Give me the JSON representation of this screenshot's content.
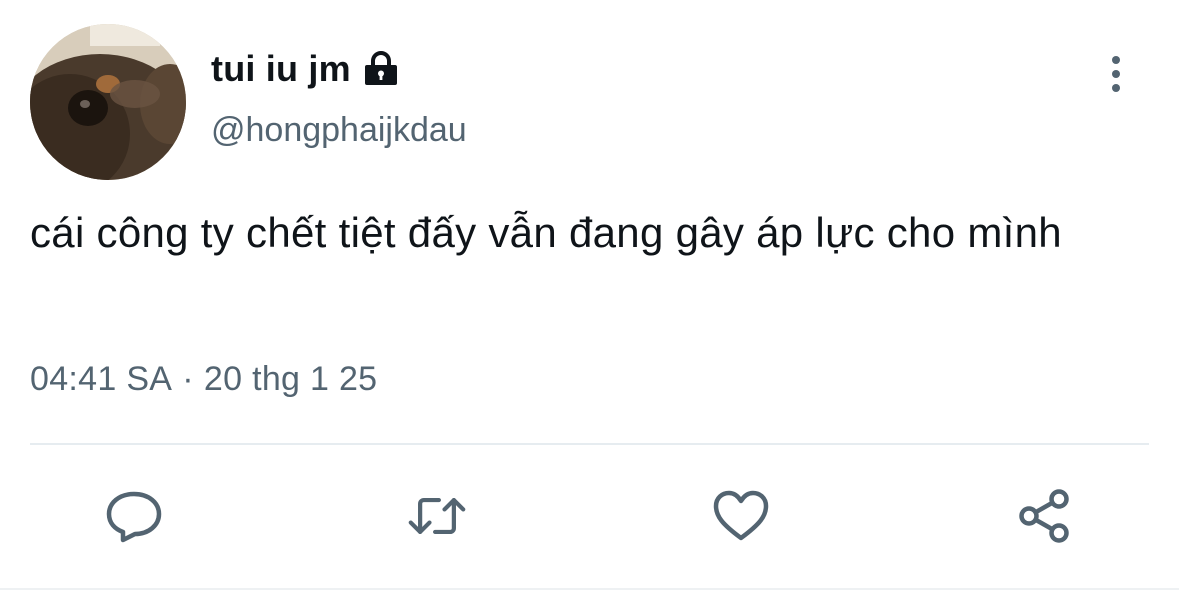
{
  "author": {
    "display_name": "tui iu jm",
    "handle": "@hongphaijkdau",
    "protected_icon": "lock-icon",
    "avatar": "dog-photo-avatar"
  },
  "tweet": {
    "text": "cái công ty chết tiệt đấy vẫn đang gây áp lực cho mình"
  },
  "meta": {
    "time": "04:41 SA",
    "separator": "·",
    "date": "20 thg 1 25"
  },
  "header": {
    "more_icon": "more-vertical-icon"
  },
  "actions": {
    "reply_icon": "reply-icon",
    "retweet_icon": "retweet-icon",
    "like_icon": "heart-icon",
    "share_icon": "share-icon"
  },
  "colors": {
    "text_primary": "#0f1419",
    "text_secondary": "#536471",
    "icon_gray": "#536471",
    "divider": "#e6ecf0"
  }
}
